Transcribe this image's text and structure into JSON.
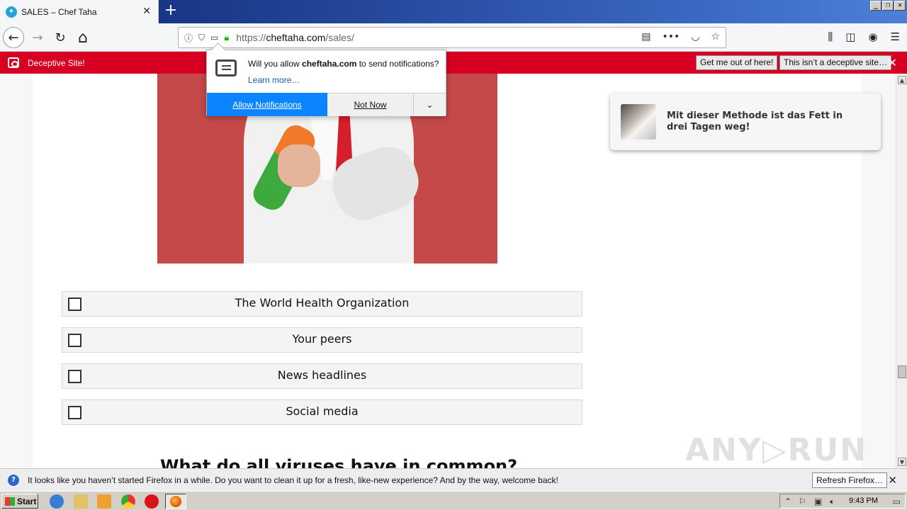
{
  "tab": {
    "title": "SALES – Chef Taha",
    "close": "✕"
  },
  "new_tab": "+",
  "window_controls": [
    "_",
    "❐",
    "✕"
  ],
  "nav": {
    "back_icon": "←",
    "forward_icon": "→",
    "reload_icon": "↻",
    "home_icon": "⌂",
    "url_prefix": "https://",
    "url_domain": "cheftaha.com",
    "url_path": "/sales/",
    "menu_dots": "•••"
  },
  "deceptive_bar": {
    "message": "Deceptive Site!",
    "get_out_label": "Get me out of here!",
    "not_deceptive_label": "This isn’t a deceptive site…",
    "close": "✕"
  },
  "notification_popup": {
    "question_prefix": "Will you allow ",
    "question_domain": "cheftaha.com",
    "question_suffix": " to send notifications?",
    "learn_more": "Learn more…",
    "allow_label": "Allow Notifications",
    "not_now_label": "Not Now",
    "more_icon": "⌄"
  },
  "page": {
    "options": [
      "The World Health Organization",
      "Your peers",
      "News headlines",
      "Social media"
    ],
    "question": "What do all viruses have in common?",
    "promo_text": "Mit dieser Methode ist das Fett in drei Tagen weg!",
    "watermark": "ANY▷RUN"
  },
  "refresh_bar": {
    "info_icon": "?",
    "message": "It looks like you haven’t started Firefox in a while. Do you want to clean it up for a fresh, like-new experience? And by the way, welcome back!",
    "button_label": "Refresh Firefox…",
    "close": "✕"
  },
  "taskbar": {
    "start_label": "Start",
    "clock": "9:43 PM"
  }
}
